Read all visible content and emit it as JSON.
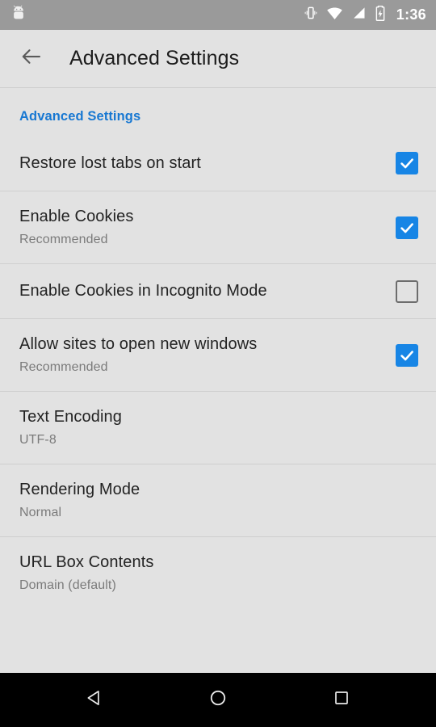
{
  "status_bar": {
    "notification_icon": "android-robot-icon",
    "icons": [
      "vibrate-icon",
      "wifi-icon",
      "cellular-signal-icon",
      "battery-charging-icon"
    ],
    "time": "1:36",
    "background_color": "#9a9a9a",
    "foreground_color": "#ffffff"
  },
  "toolbar": {
    "back_icon": "arrow-back-icon",
    "title": "Advanced Settings"
  },
  "list": {
    "section_header": "Advanced Settings",
    "accent_color": "#1878d2",
    "checkbox_checked_color": "#1785e5",
    "items": [
      {
        "title": "Restore lost tabs on start",
        "subtitle": "",
        "control": "checkbox",
        "checked": true,
        "divider_above": false
      },
      {
        "title": "Enable Cookies",
        "subtitle": "Recommended",
        "control": "checkbox",
        "checked": true,
        "divider_above": true
      },
      {
        "title": "Enable Cookies in Incognito Mode",
        "subtitle": "",
        "control": "checkbox",
        "checked": false,
        "divider_above": true
      },
      {
        "title": "Allow sites to open new windows",
        "subtitle": "Recommended",
        "control": "checkbox",
        "checked": true,
        "divider_above": true
      },
      {
        "title": "Text Encoding",
        "subtitle": "UTF-8",
        "control": "none",
        "checked": false,
        "divider_above": true
      },
      {
        "title": "Rendering Mode",
        "subtitle": "Normal",
        "control": "none",
        "checked": false,
        "divider_above": true
      },
      {
        "title": "URL Box Contents",
        "subtitle": "Domain (default)",
        "control": "none",
        "checked": false,
        "divider_above": true
      }
    ]
  },
  "nav_bar": {
    "background_color": "#000000",
    "buttons": [
      {
        "name": "back-nav-button",
        "icon": "triangle-back-icon"
      },
      {
        "name": "home-nav-button",
        "icon": "circle-home-icon"
      },
      {
        "name": "recents-nav-button",
        "icon": "square-recents-icon"
      }
    ]
  }
}
